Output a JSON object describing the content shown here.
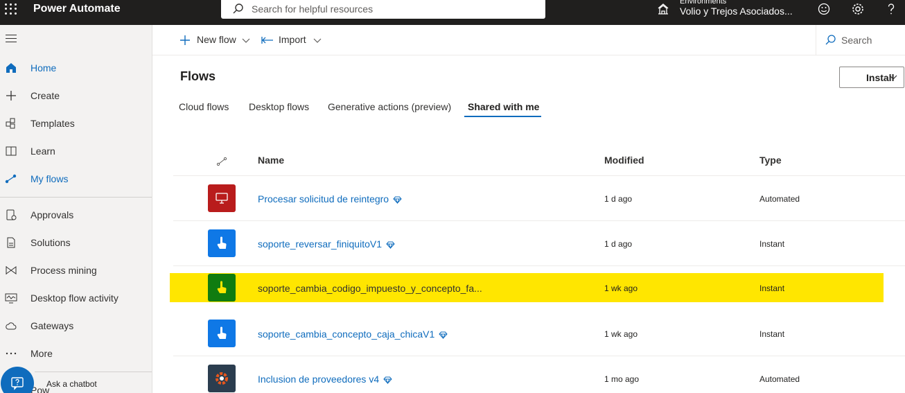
{
  "topbar": {
    "app_name": "Power Automate",
    "search_placeholder": "Search for helpful resources",
    "env_label": "Environments",
    "env_name": "Volio y Trejos Asociados...",
    "icons": [
      "waffle-icon",
      "search-icon",
      "environment-icon",
      "smiley-icon",
      "gear-icon",
      "help-icon"
    ]
  },
  "nav": {
    "items": [
      {
        "label": "Home",
        "icon": "home-icon"
      },
      {
        "label": "Create",
        "icon": "plus-icon"
      },
      {
        "label": "Templates",
        "icon": "templates-icon"
      },
      {
        "label": "Learn",
        "icon": "book-icon"
      },
      {
        "label": "My flows",
        "icon": "flows-icon"
      },
      {
        "label": "Approvals",
        "icon": "approvals-icon"
      },
      {
        "label": "Solutions",
        "icon": "solutions-icon"
      },
      {
        "label": "Process mining",
        "icon": "process-mining-icon"
      },
      {
        "label": "Desktop flow activity",
        "icon": "monitor-icon"
      },
      {
        "label": "Gateways",
        "icon": "cloud-icon"
      },
      {
        "label": "More",
        "icon": "more-icon"
      }
    ],
    "chatbot_label": "Ask a chatbot",
    "partial_label": "Pow"
  },
  "cmdbar": {
    "new_flow": "New flow",
    "import": "Import",
    "search": "Search"
  },
  "main": {
    "title": "Flows",
    "install": "Install",
    "tabs": [
      "Cloud flows",
      "Desktop flows",
      "Generative actions (preview)",
      "Shared with me"
    ],
    "active_tab": "Shared with me",
    "columns": {
      "name": "Name",
      "modified": "Modified",
      "type": "Type"
    },
    "rows": [
      {
        "name": "Procesar solicitud de reintegro",
        "modified": "1 d ago",
        "type": "Automated",
        "icon": "sql-icon",
        "icon_color": "#b91c1c",
        "premium": true
      },
      {
        "name": "soporte_reversar_finiquitoV1",
        "modified": "1 d ago",
        "type": "Instant",
        "icon": "touch-icon",
        "icon_color": "#0f78e6",
        "premium": true
      },
      {
        "name": "soporte_cambia_codigo_impuesto_y_concepto_fa...",
        "modified": "1 wk ago",
        "type": "Instant",
        "icon": "touch-icon",
        "icon_color": "#107c10",
        "premium": false
      },
      {
        "name": "soporte_cambia_concepto_caja_chicaV1",
        "modified": "1 wk ago",
        "type": "Instant",
        "icon": "touch-icon",
        "icon_color": "#0f78e6",
        "premium": true
      },
      {
        "name": "Inclusion de proveedores v4",
        "modified": "1 mo ago",
        "type": "Automated",
        "icon": "connector-icon",
        "icon_color": "#2b3d4f",
        "premium": true
      }
    ]
  },
  "colors": {
    "accent": "#0f6cbd",
    "highlight": "#ffe600",
    "topbar": "#201f1e"
  }
}
